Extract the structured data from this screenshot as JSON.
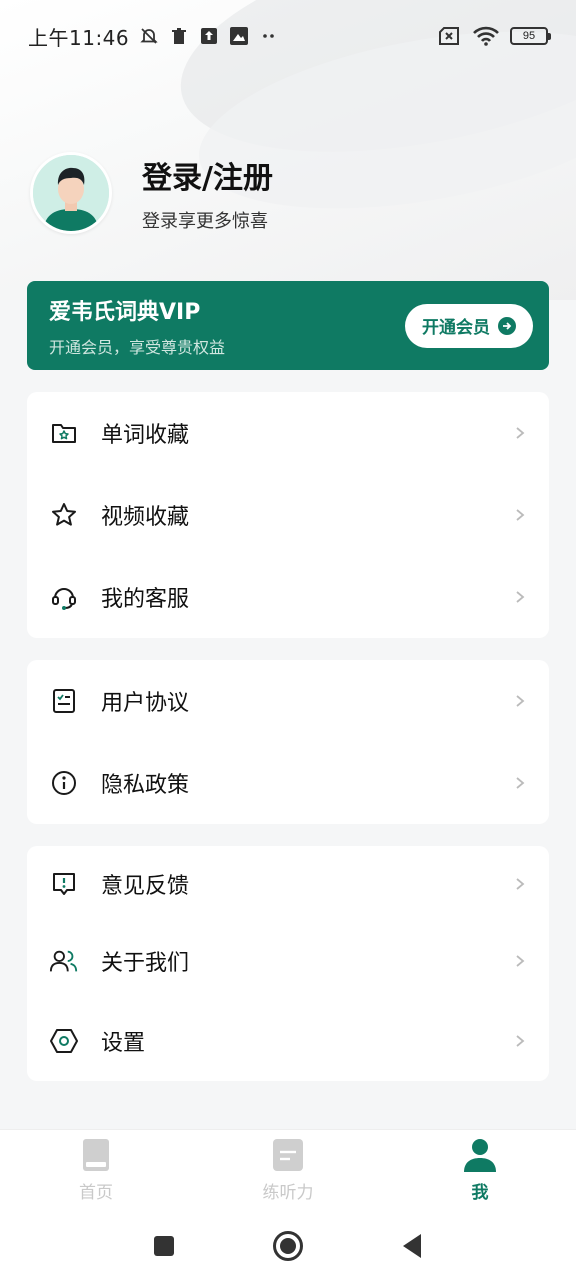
{
  "status_bar": {
    "time": "上午11:46",
    "battery": "95",
    "icons": [
      "mute-bell-icon",
      "trash-icon",
      "upload-icon",
      "gallery-icon",
      "more-dots-icon",
      "sim-none-icon",
      "wifi-icon",
      "battery-icon"
    ]
  },
  "profile": {
    "title": "登录/注册",
    "subtitle": "登录享更多惊喜"
  },
  "vip": {
    "title": "爱韦氏词典VIP",
    "subtitle": "开通会员，享受尊贵权益",
    "button_label": "开通会员",
    "color": "#0f7a63"
  },
  "menu_groups": [
    {
      "items": [
        {
          "label": "单词收藏",
          "icon": "folder-star-icon"
        },
        {
          "label": "视频收藏",
          "icon": "star-icon"
        },
        {
          "label": "我的客服",
          "icon": "headset-icon"
        }
      ]
    },
    {
      "items": [
        {
          "label": "用户协议",
          "icon": "checklist-icon"
        },
        {
          "label": "隐私政策",
          "icon": "info-icon"
        }
      ]
    },
    {
      "items": [
        {
          "label": "意见反馈",
          "icon": "feedback-icon"
        },
        {
          "label": "关于我们",
          "icon": "users-icon"
        },
        {
          "label": "设置",
          "icon": "settings-hexagon-icon"
        }
      ]
    }
  ],
  "bottom_nav": {
    "items": [
      {
        "label": "首页",
        "icon": "book-icon",
        "active": false
      },
      {
        "label": "练听力",
        "icon": "document-icon",
        "active": false
      },
      {
        "label": "我",
        "icon": "person-icon",
        "active": true
      }
    ],
    "active_color": "#0f7a63",
    "inactive_color": "#c9c9c9"
  },
  "system_nav": [
    "recents-square-icon",
    "home-circle-icon",
    "back-triangle-icon"
  ]
}
